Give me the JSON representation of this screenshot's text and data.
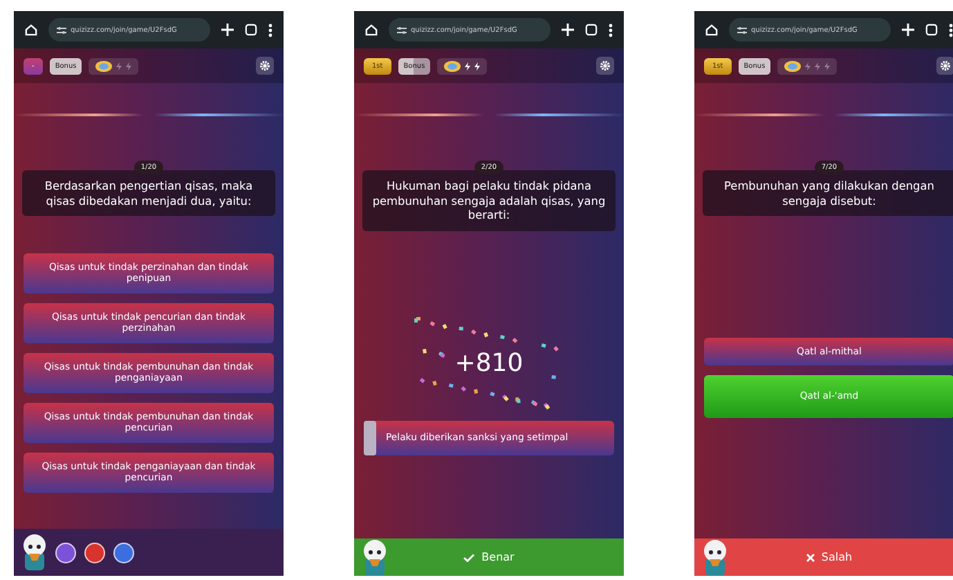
{
  "phones": [
    {
      "browser": {
        "url": "quizizz.com/join/game/U2FsdG"
      },
      "hud": {
        "rank": {
          "text": "-",
          "gold": false
        },
        "bonus": {
          "label": "Bonus",
          "level": 1
        },
        "streak": [
          {
            "lit": false
          },
          {
            "lit": false
          }
        ]
      },
      "question": {
        "counter": "1/20",
        "text": "Berdasarkan pengertian qisas, maka qisas dibedakan menjadi dua, yaitu:"
      },
      "options": [
        {
          "text": "Qisas untuk tindak perzinahan dan tindak penipuan",
          "selected": false,
          "correct": false
        },
        {
          "text": "Qisas untuk tindak pencurian dan tindak perzinahan",
          "selected": false,
          "correct": false
        },
        {
          "text": "Qisas untuk tindak pembunuhan dan tindak penganiayaan",
          "selected": false,
          "correct": false
        },
        {
          "text": "Qisas untuk tindak pembunuhan dan tindak pencurian",
          "selected": false,
          "correct": false
        },
        {
          "text": "Qisas untuk tindak penganiayaan dan tindak pencurian",
          "selected": false,
          "correct": false
        }
      ],
      "footer": {
        "kind": "powerups",
        "powerups": [
          {
            "color": "#7b52d8"
          },
          {
            "color": "#d8332c"
          },
          {
            "color": "#3c6ee0"
          }
        ]
      }
    },
    {
      "browser": {
        "url": "quizizz.com/join/game/U2FsdG"
      },
      "hud": {
        "rank": {
          "text": "1st",
          "gold": true
        },
        "bonus": {
          "label": "Bonus",
          "level": 0.5
        },
        "streak": [
          {
            "lit": true
          },
          {
            "lit": true
          }
        ]
      },
      "question": {
        "counter": "2/20",
        "text": "Hukuman bagi pelaku tindak pidana pembunuhan sengaja adalah qisas, yang berarti:"
      },
      "points": "+810",
      "options": [
        {
          "text": "Pelaku diberikan sanksi yang setimpal",
          "selected": true,
          "correct": false
        }
      ],
      "footer": {
        "kind": "correct",
        "label": "Benar"
      }
    },
    {
      "browser": {
        "url": "quizizz.com/join/game/U2FsdG"
      },
      "hud": {
        "rank": {
          "text": "1st",
          "gold": true
        },
        "bonus": {
          "label": "Bonus",
          "level": 1
        },
        "streak": [
          {
            "lit": false
          },
          {
            "lit": false
          },
          {
            "lit": false
          }
        ]
      },
      "question": {
        "counter": "7/20",
        "text": "Pembunuhan yang dilakukan dengan sengaja disebut:"
      },
      "options": [
        {
          "text": "Qatl al-mithal",
          "selected": false,
          "correct": false
        },
        {
          "text": "Qatl al-'amd",
          "selected": false,
          "correct": true
        }
      ],
      "footer": {
        "kind": "wrong",
        "label": "Salah"
      }
    }
  ]
}
